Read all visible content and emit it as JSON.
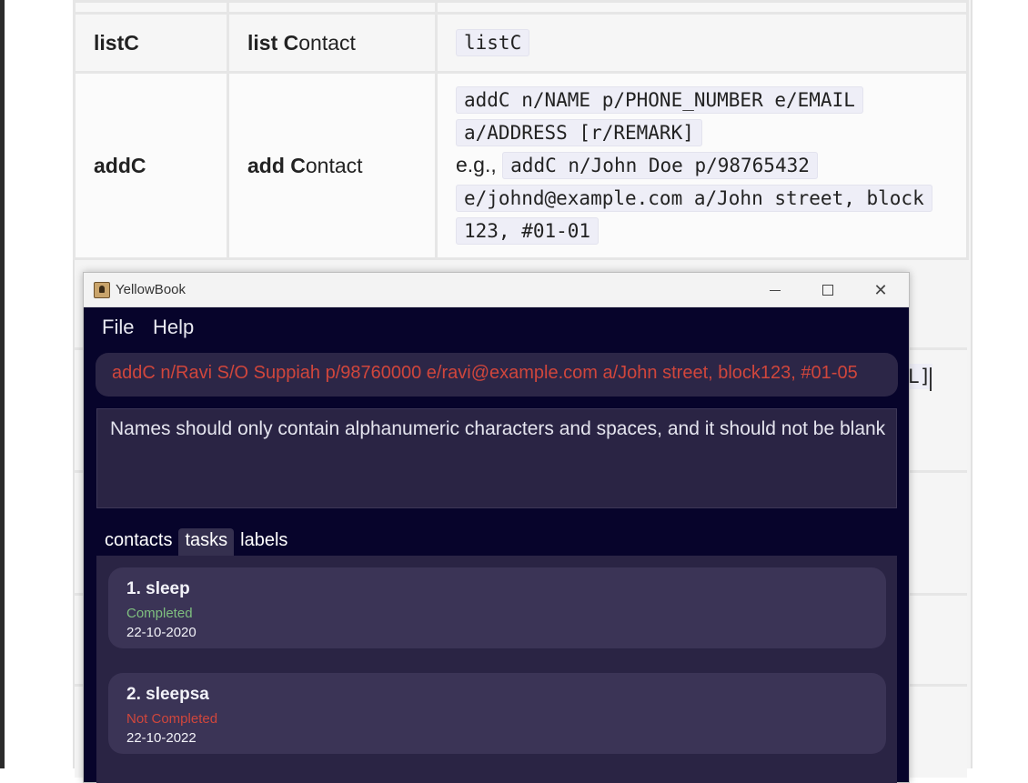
{
  "doc": {
    "rows": [
      {
        "command": "listC",
        "action_bold": "list C",
        "action_rest": "ontact",
        "format": "listC"
      },
      {
        "command": "addC",
        "action_bold": "add C",
        "action_rest": "ontact",
        "format_line1": "addC n/NAME p/PHONE_NUMBER e/EMAIL",
        "format_line2": "a/ADDRESS [r/REMARK]",
        "example_prefix": "e.g.,",
        "example_line1": "addC n/John Doe p/98765432",
        "example_line2": "e/johnd@example.com a/John street, block",
        "example_line3": "123, #01-01"
      }
    ],
    "peek_text": "L]"
  },
  "window": {
    "title": "YellowBook",
    "menu": {
      "file": "File",
      "help": "Help"
    },
    "command_value": "addC n/Ravi S/O Suppiah p/98760000 e/ravi@example.com a/John street, block123, #01-05",
    "result_message": "Names should only contain alphanumeric characters and spaces, and it should not be blank",
    "tabs": [
      {
        "label": "contacts",
        "active": false
      },
      {
        "label": "tasks",
        "active": true
      },
      {
        "label": "labels",
        "active": false
      }
    ],
    "tasks": [
      {
        "title": "1.  sleep",
        "status": "Completed",
        "status_color": "#7fbf7f",
        "date": "22-10-2020"
      },
      {
        "title": "2.  sleepsa",
        "status": "Not Completed",
        "status_color": "#d0463c",
        "date": "22-10-2022"
      }
    ]
  }
}
